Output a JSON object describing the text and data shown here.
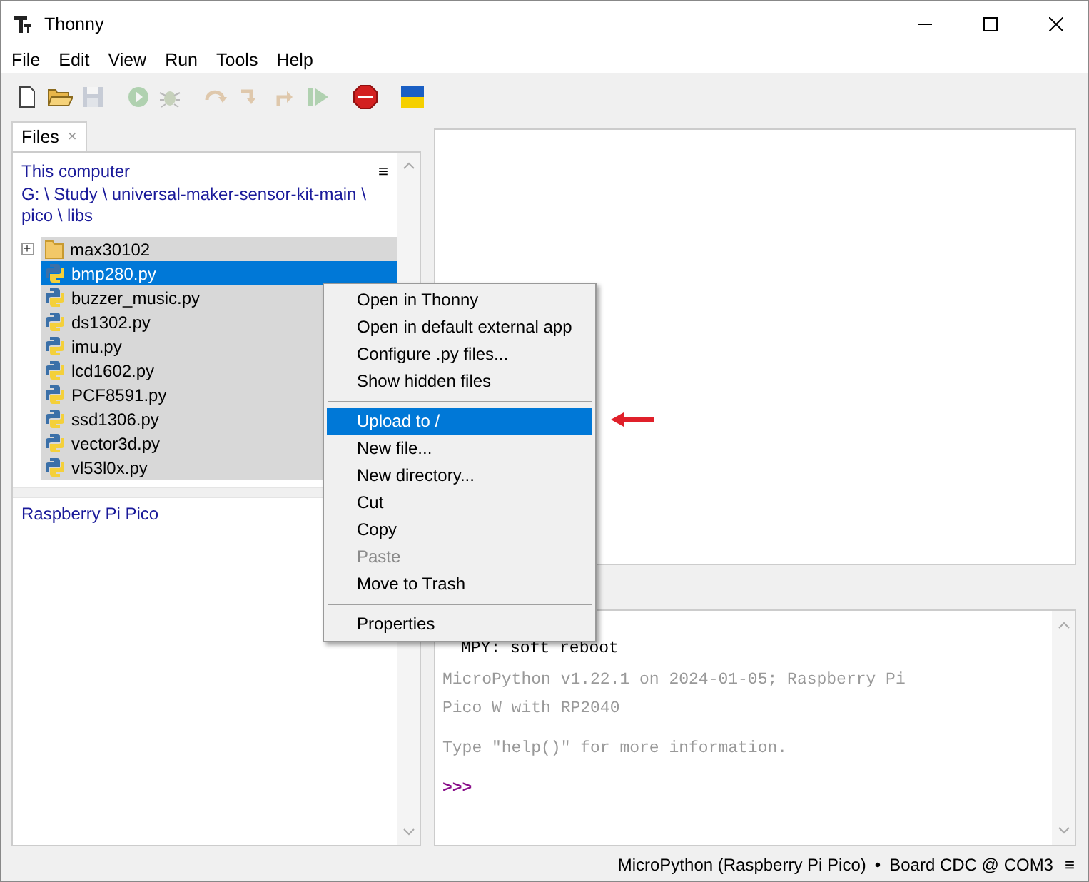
{
  "window": {
    "title": "Thonny"
  },
  "menu_bar": [
    "File",
    "Edit",
    "View",
    "Run",
    "Tools",
    "Help"
  ],
  "toolbar": [
    {
      "kind": "new",
      "disabled": false
    },
    {
      "kind": "open",
      "disabled": false
    },
    {
      "kind": "save",
      "disabled": true
    },
    {
      "kind": "run",
      "disabled": true
    },
    {
      "kind": "debug",
      "disabled": true
    },
    {
      "kind": "step-over",
      "disabled": true
    },
    {
      "kind": "step-into",
      "disabled": true
    },
    {
      "kind": "step-out",
      "disabled": true
    },
    {
      "kind": "resume",
      "disabled": true
    },
    {
      "kind": "stop",
      "disabled": false
    },
    {
      "kind": "flag",
      "disabled": false
    }
  ],
  "files_tab": {
    "label": "Files",
    "close": "×",
    "selected": true
  },
  "local": {
    "title": "This computer",
    "menu": "≡",
    "path": "G: \\ Study \\ universal-maker-sensor-kit-main \\ pico \\ libs",
    "items": [
      {
        "kind": "folder",
        "name": "max30102",
        "expander": "+",
        "selected": true,
        "focused": false
      },
      {
        "kind": "file",
        "name": "bmp280.py",
        "selected": true,
        "focused": true
      },
      {
        "kind": "file",
        "name": "buzzer_music.py",
        "selected": true,
        "focused": false
      },
      {
        "kind": "file",
        "name": "ds1302.py",
        "selected": true,
        "focused": false
      },
      {
        "kind": "file",
        "name": "imu.py",
        "selected": true,
        "focused": false
      },
      {
        "kind": "file",
        "name": "lcd1602.py",
        "selected": true,
        "focused": false
      },
      {
        "kind": "file",
        "name": "PCF8591.py",
        "selected": true,
        "focused": false
      },
      {
        "kind": "file",
        "name": "ssd1306.py",
        "selected": true,
        "focused": false
      },
      {
        "kind": "file",
        "name": "vector3d.py",
        "selected": true,
        "focused": false
      },
      {
        "kind": "file",
        "name": "vl53l0x.py",
        "selected": true,
        "focused": false
      }
    ]
  },
  "device": {
    "title": "Raspberry Pi Pico"
  },
  "context_menu": [
    {
      "kind": "item",
      "label": "Open in Thonny",
      "disabled": false,
      "selected": false
    },
    {
      "kind": "item",
      "label": "Open in default external app",
      "disabled": false,
      "selected": false
    },
    {
      "kind": "item",
      "label": "Configure .py files...",
      "disabled": false,
      "selected": false
    },
    {
      "kind": "item",
      "label": "Show hidden files",
      "disabled": false,
      "selected": false
    },
    {
      "kind": "separator"
    },
    {
      "kind": "item",
      "label": "Upload to /",
      "disabled": false,
      "selected": true
    },
    {
      "kind": "item",
      "label": "New file...",
      "disabled": false,
      "selected": false
    },
    {
      "kind": "item",
      "label": "New directory...",
      "disabled": false,
      "selected": false
    },
    {
      "kind": "item",
      "label": "Cut",
      "disabled": false,
      "selected": false
    },
    {
      "kind": "item",
      "label": "Copy",
      "disabled": false,
      "selected": false
    },
    {
      "kind": "item",
      "label": "Paste",
      "disabled": true,
      "selected": false
    },
    {
      "kind": "item",
      "label": "Move to Trash",
      "disabled": false,
      "selected": false
    },
    {
      "kind": "separator"
    },
    {
      "kind": "item",
      "label": "Properties",
      "disabled": false,
      "selected": false
    }
  ],
  "shell": [
    {
      "kind": "output",
      "text": "MPY: soft reboot"
    },
    {
      "kind": "info",
      "text": "MicroPython v1.22.1 on 2024-01-05; Raspberry Pi Pico W with RP2040"
    },
    {
      "kind": "info",
      "text": "Type \"help()\" for more information."
    },
    {
      "kind": "prompt",
      "text": ">>>"
    }
  ],
  "status_bar": {
    "interpreter": "MicroPython (Raspberry Pi Pico)",
    "separator": "•",
    "port": "Board CDC @ COM3",
    "menu": "≡"
  }
}
